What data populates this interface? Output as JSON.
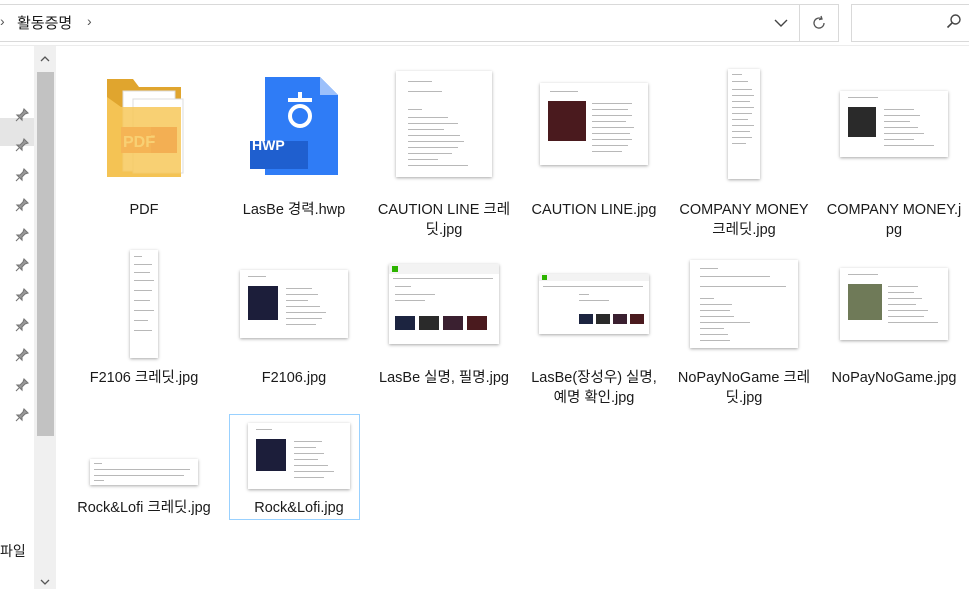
{
  "address": {
    "crumb": "활동증명"
  },
  "nav": {
    "label": "파일"
  },
  "files": [
    {
      "name": "PDF",
      "type": "folder"
    },
    {
      "name": "LasBe 경력.hwp",
      "type": "hwp",
      "badge": "HWP"
    },
    {
      "name": "CAUTION LINE 크레딧.jpg",
      "type": "credit-doc"
    },
    {
      "name": "CAUTION LINE.jpg",
      "type": "album-sheet"
    },
    {
      "name": "COMPANY MONEY 크레딧.jpg",
      "type": "tall-doc"
    },
    {
      "name": "COMPANY MONEY.jpg",
      "type": "album-sheet"
    },
    {
      "name": "F2106 크레딧.jpg",
      "type": "tall-doc"
    },
    {
      "name": "F2106.jpg",
      "type": "album-sheet"
    },
    {
      "name": "LasBe 실명, 필명.jpg",
      "type": "web-page"
    },
    {
      "name": "LasBe(장성우) 실명, 예명 확인.jpg",
      "type": "web-page"
    },
    {
      "name": "NoPayNoGame 크레딧.jpg",
      "type": "credit-doc"
    },
    {
      "name": "NoPayNoGame.jpg",
      "type": "album-sheet"
    },
    {
      "name": "Rock&Lofi 크레딧.jpg",
      "type": "wide-doc"
    },
    {
      "name": "Rock&Lofi.jpg",
      "type": "album-sheet",
      "selected": true
    }
  ],
  "colors": {
    "selection_border": "#99d1ff",
    "hwp_blue": "#2f7cf6",
    "hwp_dark": "#1f5fcf",
    "folder": "#f5c542"
  }
}
